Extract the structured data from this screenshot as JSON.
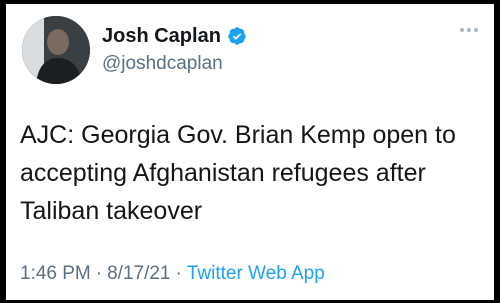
{
  "tweet": {
    "author": {
      "display_name": "Josh Caplan",
      "handle": "@joshdcaplan",
      "verified": true
    },
    "text": "AJC: Georgia Gov. Brian Kemp open to accepting Afghanistan refugees after Taliban takeover",
    "time": "1:46 PM",
    "date": "8/17/21",
    "separator": "·",
    "source": "Twitter Web App"
  },
  "icons": {
    "verified": "verified-badge-icon",
    "more": "more-options-icon"
  },
  "colors": {
    "background": "#000000",
    "card": "#ffffff",
    "text_primary": "#14171a",
    "text_secondary": "#5b7083",
    "accent": "#1da1f2"
  }
}
